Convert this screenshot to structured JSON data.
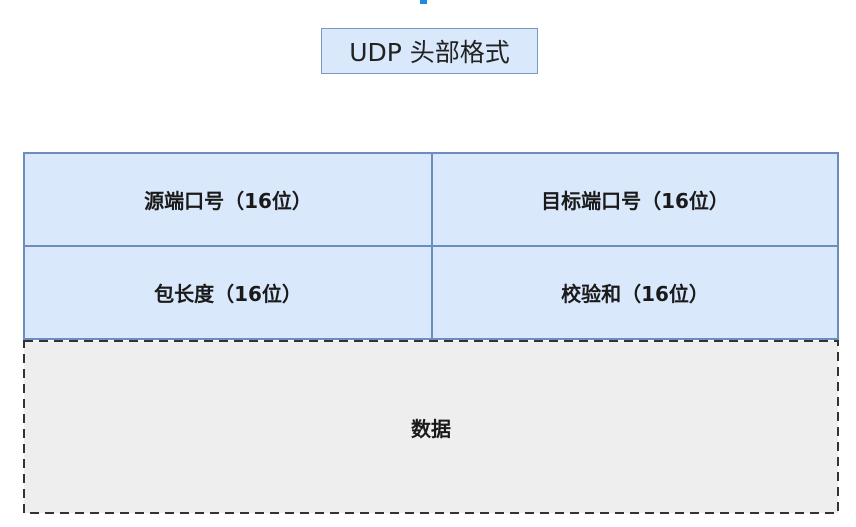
{
  "title": "UDP 头部格式",
  "fields": {
    "source_port": "源端口号（16位）",
    "dest_port": "目标端口号（16位）",
    "length": "包长度（16位）",
    "checksum": "校验和（16位）",
    "data": "数据"
  },
  "colors": {
    "header_fill": "#dae8fc",
    "header_stroke": "#6c8ebf",
    "data_fill": "#eeeeee",
    "data_stroke": "#333333",
    "title_fill": "#dae8fc",
    "accent": "#1e88e5"
  }
}
